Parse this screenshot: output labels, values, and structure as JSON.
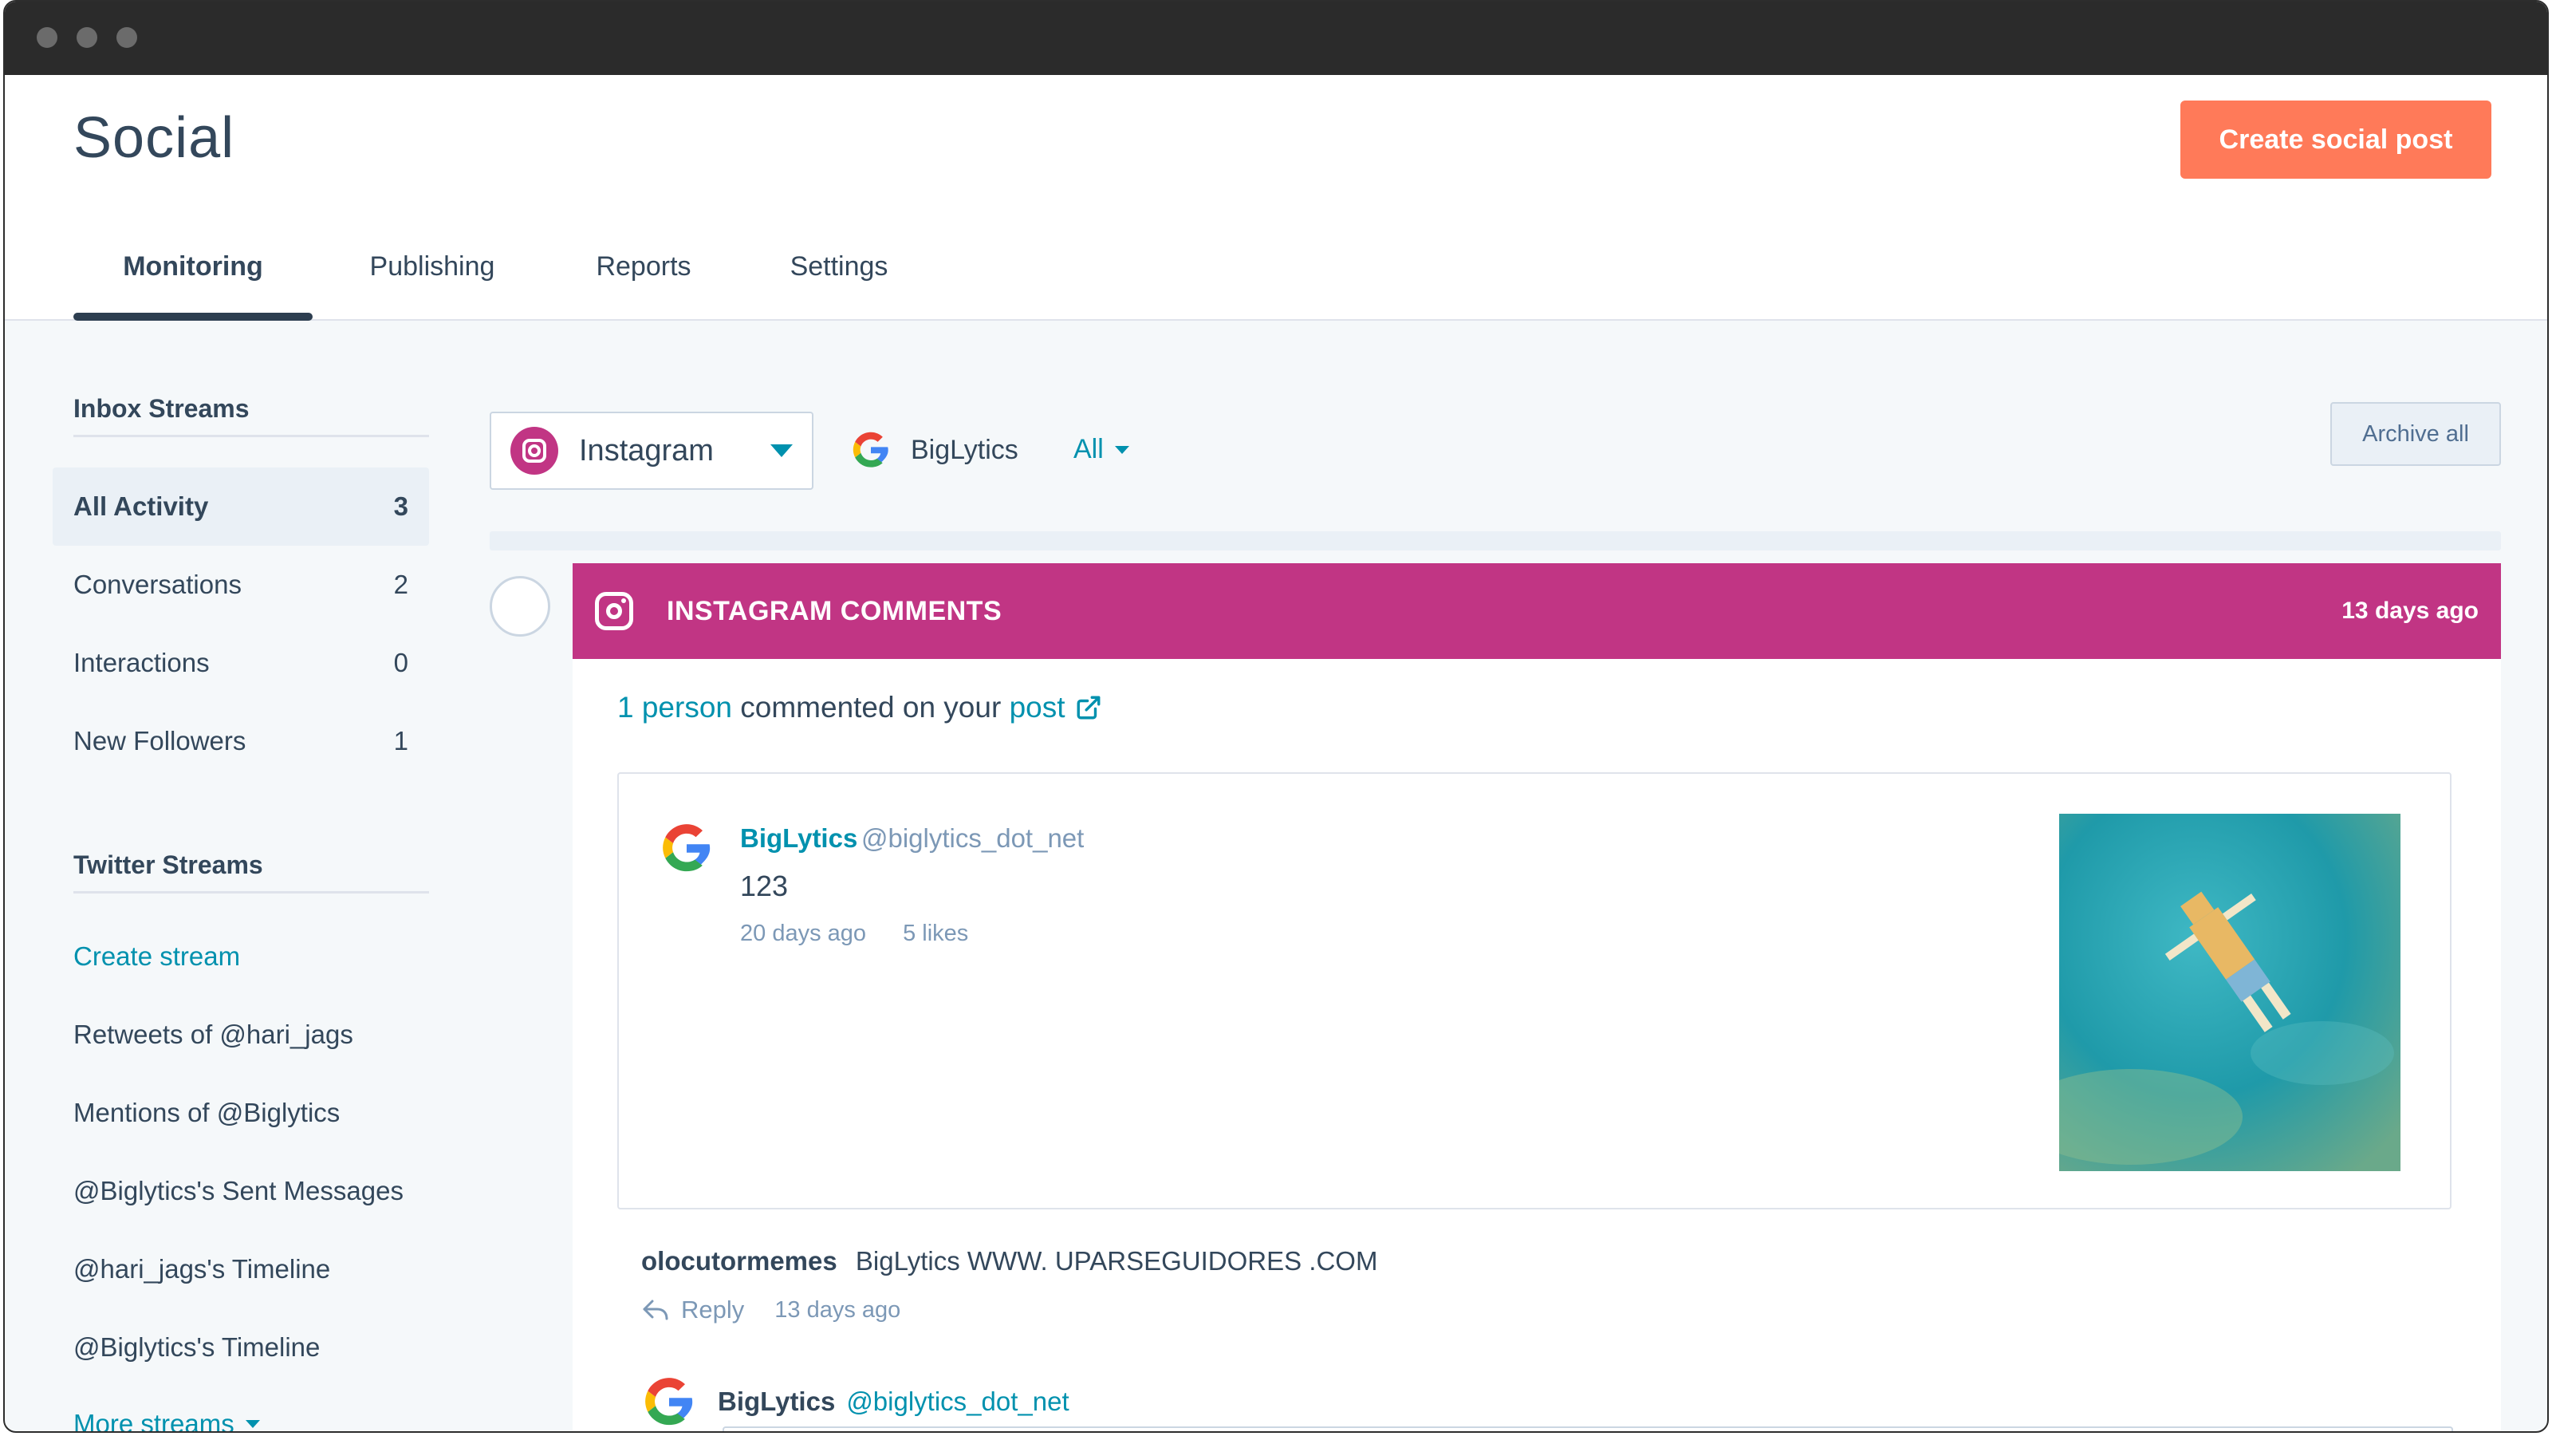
{
  "window": {
    "controls": [
      "close",
      "minimize",
      "zoom"
    ]
  },
  "header": {
    "title": "Social",
    "create_button": "Create social post",
    "tabs": [
      {
        "label": "Monitoring",
        "active": true
      },
      {
        "label": "Publishing",
        "active": false
      },
      {
        "label": "Reports",
        "active": false
      },
      {
        "label": "Settings",
        "active": false
      }
    ]
  },
  "sidebar": {
    "inbox_heading": "Inbox Streams",
    "inbox_items": [
      {
        "label": "All Activity",
        "count": "3",
        "active": true
      },
      {
        "label": "Conversations",
        "count": "2",
        "active": false
      },
      {
        "label": "Interactions",
        "count": "0",
        "active": false
      },
      {
        "label": "New Followers",
        "count": "1",
        "active": false
      }
    ],
    "twitter_heading": "Twitter Streams",
    "twitter_items": [
      {
        "label": "Create stream",
        "accent": true
      },
      {
        "label": "Retweets of @hari_jags"
      },
      {
        "label": "Mentions of @Biglytics"
      },
      {
        "label": "@Biglytics's Sent Messages"
      },
      {
        "label": "@hari_jags's Timeline"
      },
      {
        "label": "@Biglytics's Timeline"
      },
      {
        "label": "More streams"
      }
    ]
  },
  "filters": {
    "network": "Instagram",
    "account": "BigLytics",
    "scope": "All",
    "archive_button": "Archive all"
  },
  "card": {
    "type": "INSTAGRAM COMMENTS",
    "time": "13 days ago",
    "summary": {
      "count_link": "1 person",
      "middle": " commented on your ",
      "post_link": "post"
    },
    "post": {
      "author": "BigLytics",
      "handle": "@biglytics_dot_net",
      "text": "123",
      "age": "20 days ago",
      "likes": "5 likes"
    },
    "comment": {
      "user": "olocutormemes",
      "text": "BigLytics WWW. UPARSEGUIDORES .COM",
      "reply_label": "Reply",
      "time": "13 days ago"
    },
    "reply_composer": {
      "name": "BigLytics",
      "handle": "@biglytics_dot_net"
    }
  },
  "colors": {
    "accent": "#0091ae",
    "primary_button": "#ff7a59",
    "instagram": "#c13584",
    "text": "#33475b",
    "muted": "#7c98b6"
  },
  "icons": [
    "instagram-icon",
    "google-icon",
    "external-link-icon",
    "reply-icon",
    "chevron-down-icon"
  ]
}
